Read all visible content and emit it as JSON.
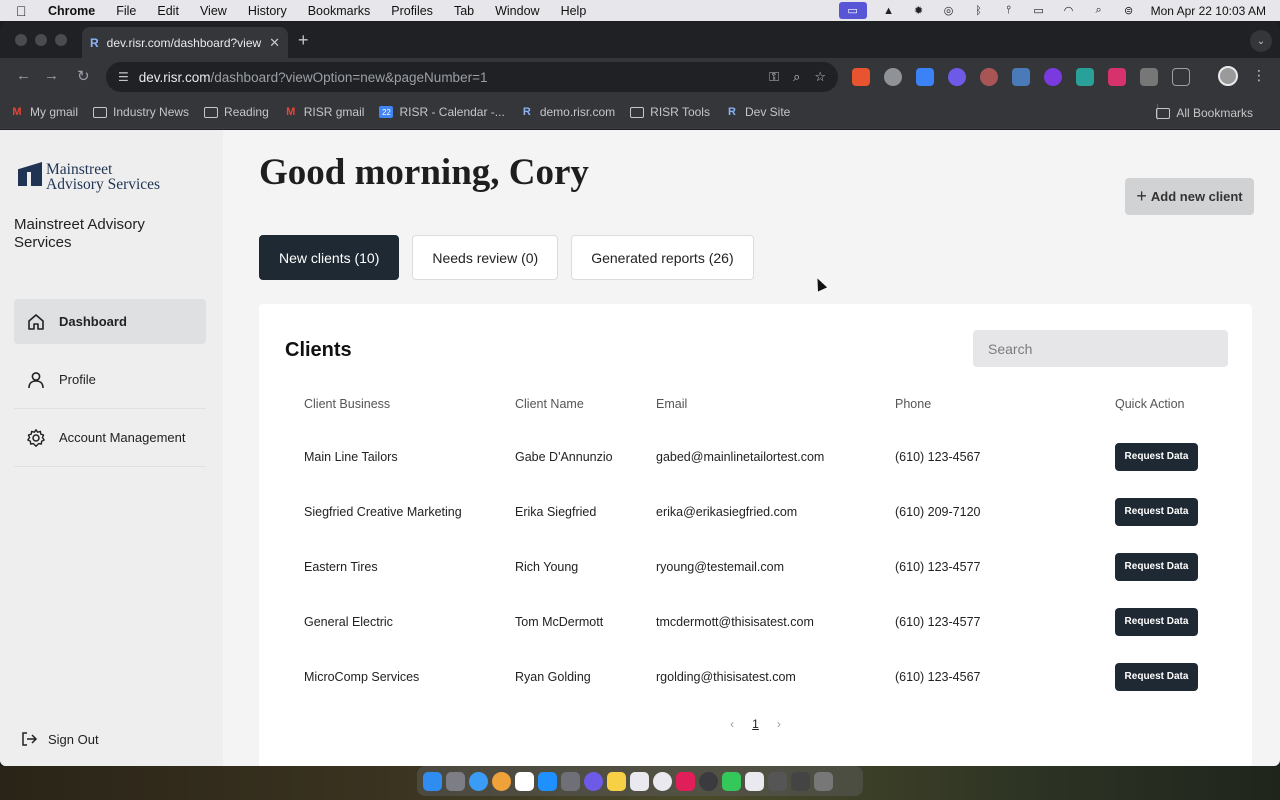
{
  "menubar": {
    "app": "Chrome",
    "items": [
      "File",
      "Edit",
      "View",
      "History",
      "Bookmarks",
      "Profiles",
      "Tab",
      "Window",
      "Help"
    ],
    "datetime": "Mon Apr 22  10:03 AM"
  },
  "browser": {
    "tab_favicon": "R",
    "tab_title": "dev.risr.com/dashboard?view",
    "url_host": "dev.risr.com",
    "url_path": "/dashboard?viewOption=new&pageNumber=1",
    "bookmarks": [
      {
        "label": "My gmail",
        "icon": "gmail-icon"
      },
      {
        "label": "Industry News",
        "icon": "folder-icon"
      },
      {
        "label": "Reading",
        "icon": "folder-icon"
      },
      {
        "label": "RISR gmail",
        "icon": "gmail-icon"
      },
      {
        "label": "RISR - Calendar -...",
        "icon": "calendar-icon"
      },
      {
        "label": "demo.risr.com",
        "icon": "r-icon"
      },
      {
        "label": "RISR Tools",
        "icon": "folder-icon"
      },
      {
        "label": "Dev Site",
        "icon": "r-icon"
      }
    ],
    "all_bookmarks": "All Bookmarks"
  },
  "sidebar": {
    "logo_line1": "Mainstreet",
    "logo_line2": "Advisory Services",
    "org_name": "Mainstreet Advisory Services",
    "items": [
      {
        "label": "Dashboard",
        "icon": "home-icon"
      },
      {
        "label": "Profile",
        "icon": "user-icon"
      },
      {
        "label": "Account Management",
        "icon": "gear-icon"
      }
    ],
    "sign_out": "Sign Out"
  },
  "main": {
    "greeting": "Good morning, Cory",
    "add_client_label": "Add new client",
    "tabs": [
      {
        "label": "New clients (10)",
        "active": true
      },
      {
        "label": "Needs review (0)",
        "active": false
      },
      {
        "label": "Generated reports (26)",
        "active": false
      }
    ],
    "card_title": "Clients",
    "search_placeholder": "Search",
    "columns": [
      "Client Business",
      "Client Name",
      "Email",
      "Phone",
      "Quick Action"
    ],
    "rows": [
      {
        "business": "Main Line Tailors",
        "name": "Gabe D'Annunzio",
        "email": "gabed@mainlinetailortest.com",
        "phone": "(610) 123-4567",
        "action": "Request Data"
      },
      {
        "business": "Siegfried Creative Marketing",
        "name": "Erika Siegfried",
        "email": "erika@erikasiegfried.com",
        "phone": "(610) 209-7120",
        "action": "Request Data"
      },
      {
        "business": "Eastern Tires",
        "name": "Rich Young",
        "email": "ryoung@testemail.com",
        "phone": "(610) 123-4577",
        "action": "Request Data"
      },
      {
        "business": "General Electric",
        "name": "Tom McDermott",
        "email": "tmcdermott@thisisatest.com",
        "phone": "(610) 123-4577",
        "action": "Request Data"
      },
      {
        "business": "MicroComp Services",
        "name": "Ryan Golding",
        "email": "rgolding@thisisatest.com",
        "phone": "(610) 123-4567",
        "action": "Request Data"
      }
    ],
    "pager": {
      "prev": "‹",
      "current": "1",
      "next": "›"
    }
  }
}
